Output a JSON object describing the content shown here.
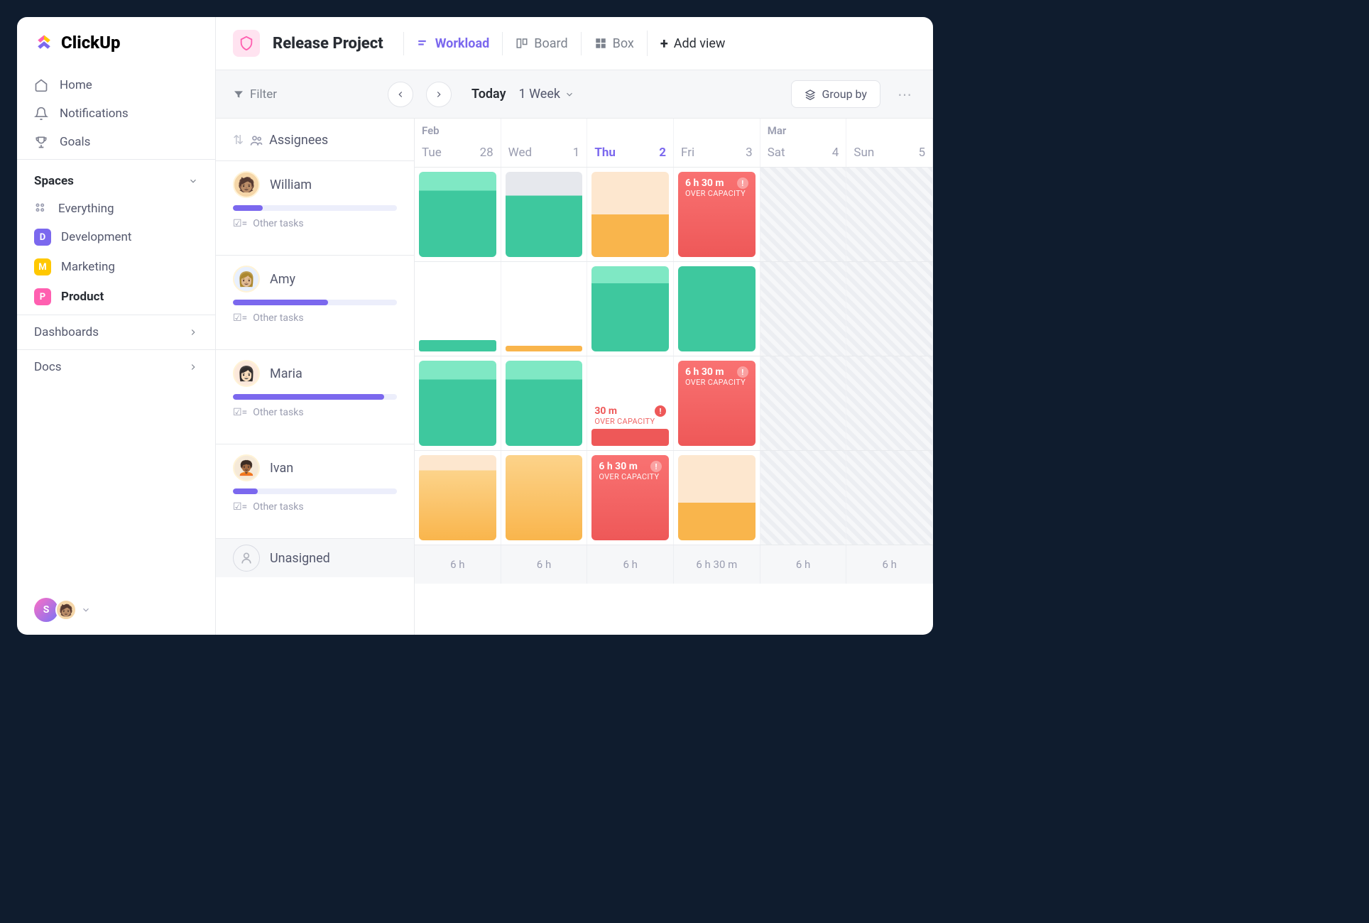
{
  "brand": "ClickUp",
  "nav": {
    "home": "Home",
    "notifications": "Notifications",
    "goals": "Goals"
  },
  "spaces_header": "Spaces",
  "spaces": {
    "everything": "Everything",
    "items": [
      {
        "letter": "D",
        "color": "#7b68ee",
        "label": "Development"
      },
      {
        "letter": "M",
        "color": "#ffc800",
        "label": "Marketing"
      },
      {
        "letter": "P",
        "color": "#ff5fb0",
        "label": "Product"
      }
    ]
  },
  "dashboards": "Dashboards",
  "docs": "Docs",
  "footer_avatar_letter": "S",
  "project": {
    "title": "Release Project"
  },
  "tabs": {
    "workload": "Workload",
    "board": "Board",
    "box": "Box",
    "add_view": "Add view"
  },
  "filterbar": {
    "filter": "Filter",
    "today": "Today",
    "range": "1 Week",
    "groupby": "Group by"
  },
  "columns": {
    "assignees": "Assignees",
    "month1": "Feb",
    "month2": "Mar",
    "days": [
      {
        "name": "Tue",
        "num": "28"
      },
      {
        "name": "Wed",
        "num": "1"
      },
      {
        "name": "Thu",
        "num": "2",
        "today": true
      },
      {
        "name": "Fri",
        "num": "3"
      },
      {
        "name": "Sat",
        "num": "4",
        "weekend": true
      },
      {
        "name": "Sun",
        "num": "5",
        "weekend": true
      }
    ]
  },
  "rows": [
    {
      "name": "William",
      "progress": 18,
      "other": "Other tasks"
    },
    {
      "name": "Amy",
      "progress": 58,
      "other": "Other tasks"
    },
    {
      "name": "Maria",
      "progress": 92,
      "other": "Other tasks"
    },
    {
      "name": "Ivan",
      "progress": 15,
      "other": "Other tasks"
    }
  ],
  "unassigned": "Unasigned",
  "overcap": {
    "time": "6 h 30 m",
    "time_short": "30 m",
    "label": "OVER CAPACITY"
  },
  "bottom": [
    "6 h",
    "6 h",
    "6 h",
    "6 h 30 m",
    "6 h",
    "6 h"
  ]
}
